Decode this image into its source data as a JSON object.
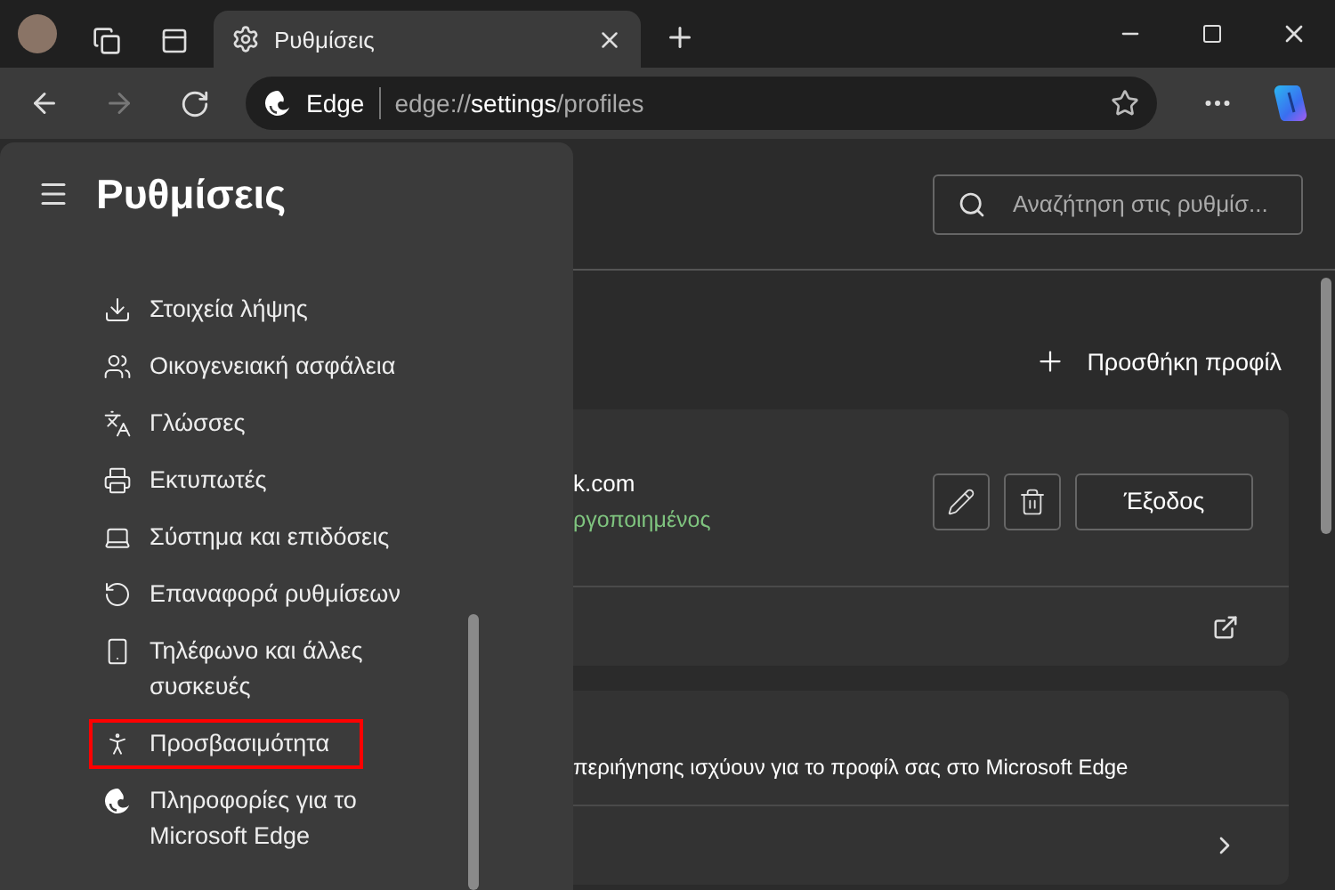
{
  "tabs": [
    {
      "title": "Ρυθμίσεις",
      "selected": true
    }
  ],
  "address_bar": {
    "site_label": "Edge",
    "url_prefix": "edge://",
    "url_bold": "settings",
    "url_suffix": "/profiles"
  },
  "sidebar": {
    "title": "Ρυθμίσεις",
    "items": [
      {
        "label": "Στοιχεία λήψης",
        "highlighted": false
      },
      {
        "label": "Οικογενειακή ασφάλεια",
        "highlighted": false
      },
      {
        "label": "Γλώσσες",
        "highlighted": false
      },
      {
        "label": "Εκτυπωτές",
        "highlighted": false
      },
      {
        "label": "Σύστημα και επιδόσεις",
        "highlighted": false
      },
      {
        "label": "Επαναφορά ρυθμίσεων",
        "highlighted": false
      },
      {
        "label": "Τηλέφωνο και άλλες συσκευές",
        "highlighted": false
      },
      {
        "label": "Προσβασιμότητα",
        "highlighted": true
      },
      {
        "label": "Πληροφορίες για το Microsoft Edge",
        "highlighted": false
      }
    ]
  },
  "search": {
    "placeholder": "Αναζήτηση στις ρυθμίσ..."
  },
  "add_profile": "Προσθήκη προφίλ",
  "profile_card": {
    "email": "k.com",
    "status": "ργοποιημένος",
    "sign_out": "Έξοδος"
  },
  "info_card": {
    "text": "περιήγησης ισχύουν για το προφίλ σας στο Microsoft Edge"
  }
}
